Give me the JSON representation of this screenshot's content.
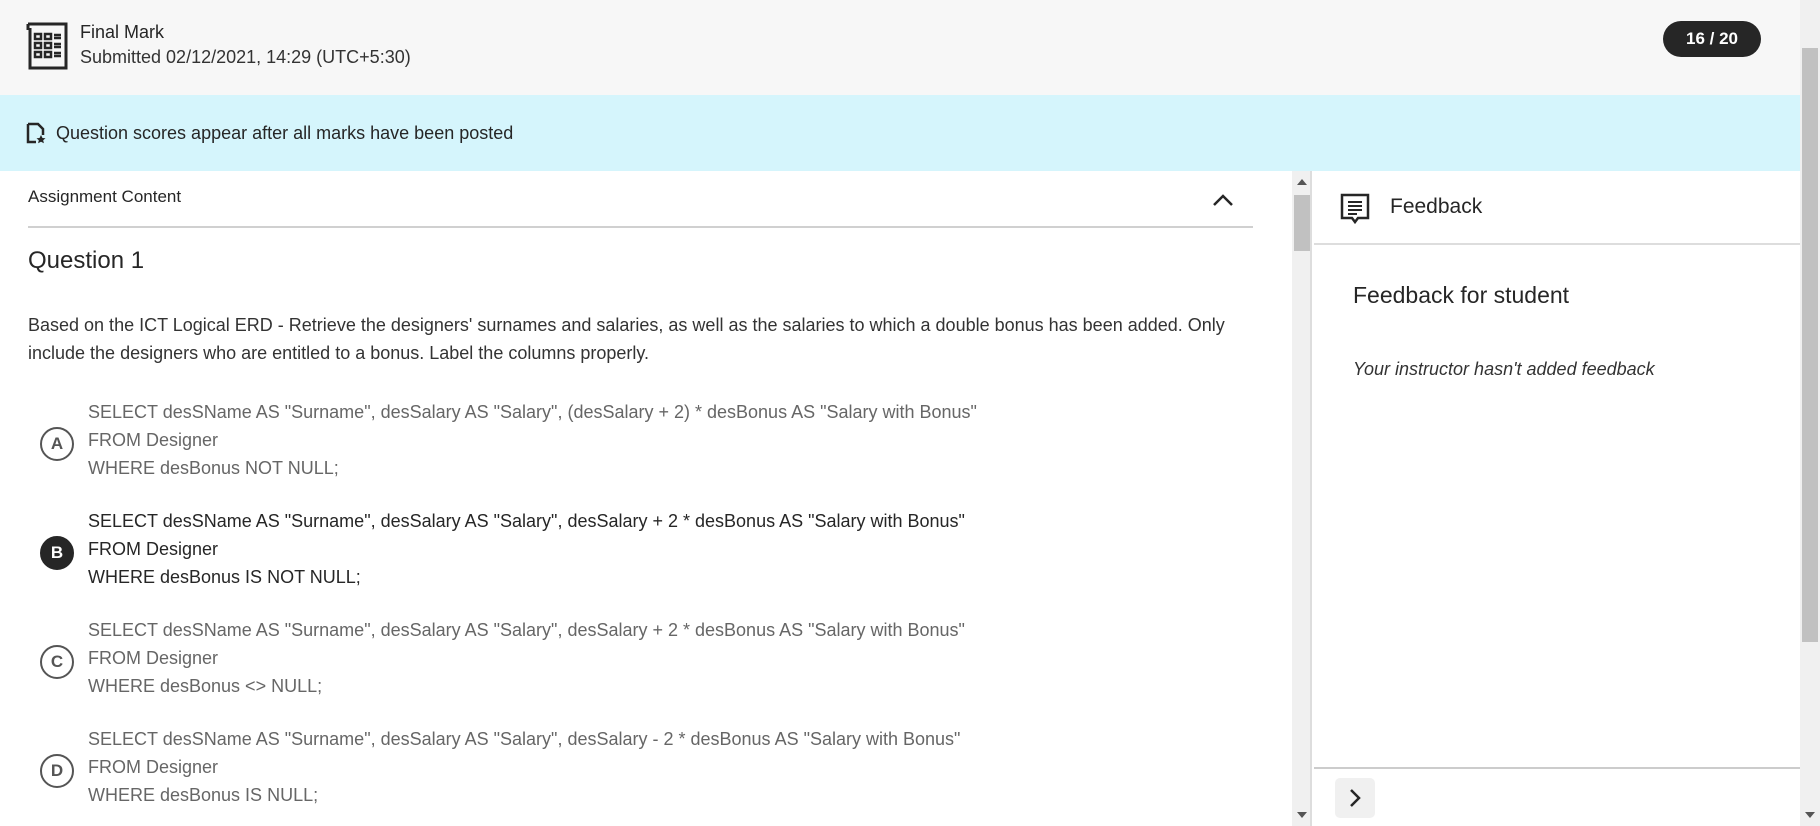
{
  "header": {
    "title": "Final Mark",
    "submitted": "Submitted 02/12/2021, 14:29 (UTC+5:30)",
    "score": "16 / 20"
  },
  "banner": {
    "text": "Question scores appear after all marks have been posted"
  },
  "content": {
    "section_title": "Assignment Content",
    "question_title": "Question 1",
    "question_text": "Based on the ICT Logical ERD - Retrieve the designers' surnames and salaries, as well as the salaries to which a double bonus has been added. Only include the designers who are entitled to a bonus. Label the columns properly.",
    "options": [
      {
        "letter": "A",
        "selected": false,
        "lines": [
          "SELECT desSName AS \"Surname\", desSalary AS \"Salary\", (desSalary + 2) * desBonus AS \"Salary with Bonus\"",
          "FROM Designer",
          "WHERE desBonus NOT NULL;"
        ]
      },
      {
        "letter": "B",
        "selected": true,
        "lines": [
          "SELECT desSName AS \"Surname\", desSalary AS \"Salary\", desSalary + 2 * desBonus AS \"Salary with Bonus\"",
          "FROM Designer",
          "WHERE desBonus IS NOT NULL;"
        ]
      },
      {
        "letter": "C",
        "selected": false,
        "lines": [
          "SELECT desSName AS \"Surname\", desSalary AS \"Salary\", desSalary + 2 * desBonus AS \"Salary with Bonus\"",
          "FROM Designer",
          "WHERE desBonus <> NULL;"
        ]
      },
      {
        "letter": "D",
        "selected": false,
        "lines": [
          "SELECT desSName AS \"Surname\", desSalary AS \"Salary\", desSalary - 2 * desBonus AS \"Salary with Bonus\"",
          "FROM Designer",
          "WHERE desBonus IS NULL;"
        ]
      }
    ]
  },
  "feedback": {
    "panel_title": "Feedback",
    "heading": "Feedback for student",
    "empty_text": "Your instructor hasn't added feedback"
  }
}
